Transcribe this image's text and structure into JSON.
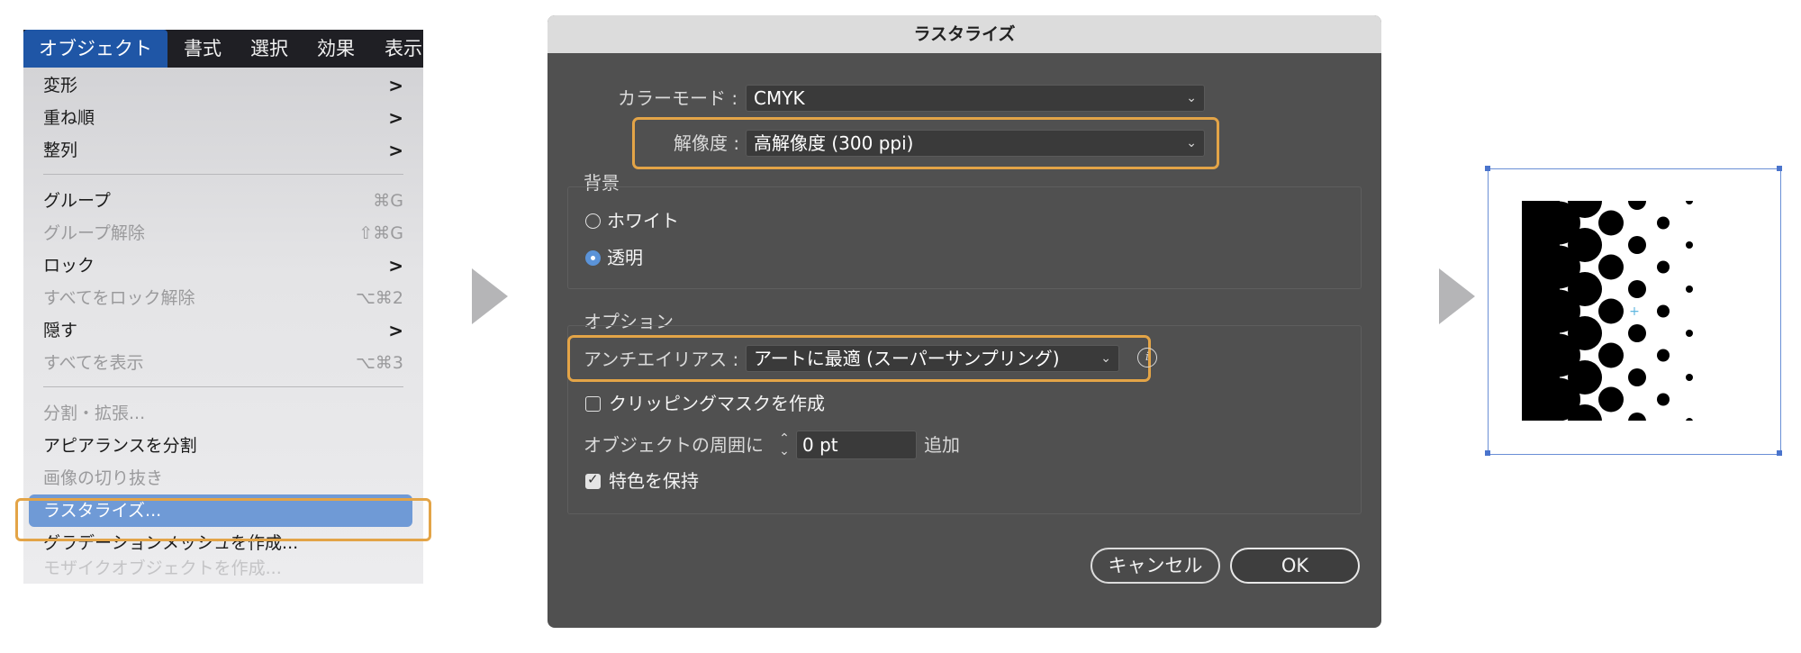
{
  "menu": {
    "bar": [
      "オブジェクト",
      "書式",
      "選択",
      "効果",
      "表示"
    ],
    "items": [
      {
        "label": "変形",
        "right": ">"
      },
      {
        "label": "重ね順",
        "right": ">"
      },
      {
        "label": "整列",
        "right": ">"
      },
      {
        "label": "グループ",
        "right": "⌘G",
        "shortcut_disabled": true
      },
      {
        "label": "グループ解除",
        "right": "⇧⌘G",
        "disabled": true
      },
      {
        "label": "ロック",
        "right": ">"
      },
      {
        "label": "すべてをロック解除",
        "right": "⌥⌘2",
        "disabled": true
      },
      {
        "label": "隠す",
        "right": ">"
      },
      {
        "label": "すべてを表示",
        "right": "⌥⌘3",
        "disabled": true
      },
      {
        "label": "分割・拡張...",
        "disabled": true
      },
      {
        "label": "アピアランスを分割"
      },
      {
        "label": "画像の切り抜き",
        "disabled": true
      },
      {
        "label": "ラスタライズ...",
        "selected": true
      },
      {
        "label": "グラデーションメッシュを作成..."
      },
      {
        "label": "モザイクオブジェクトを作成...",
        "disabled": true
      }
    ]
  },
  "dialog": {
    "title": "ラスタライズ",
    "color_mode_label": "カラーモード :",
    "color_mode_value": "CMYK",
    "resolution_label": "解像度 :",
    "resolution_value": "高解像度 (300 ppi)",
    "background_label": "背景",
    "bg_white": "ホワイト",
    "bg_transparent": "透明",
    "options_label": "オプション",
    "antialias_label": "アンチエイリアス :",
    "antialias_value": "アートに最適 (スーパーサンプリング)",
    "clipping_mask_label": "クリッピングマスクを作成",
    "around_label": "オブジェクトの周囲に",
    "around_value": "0 pt",
    "around_suffix": "追加",
    "preserve_spot_label": "特色を保持",
    "cancel_label": "キャンセル",
    "ok_label": "OK"
  },
  "colors": {
    "accent_highlight": "#e3a447",
    "menu_selection": "#6f9ad6",
    "dialog_bg": "#505050",
    "selection_box": "#6a8fd6"
  }
}
